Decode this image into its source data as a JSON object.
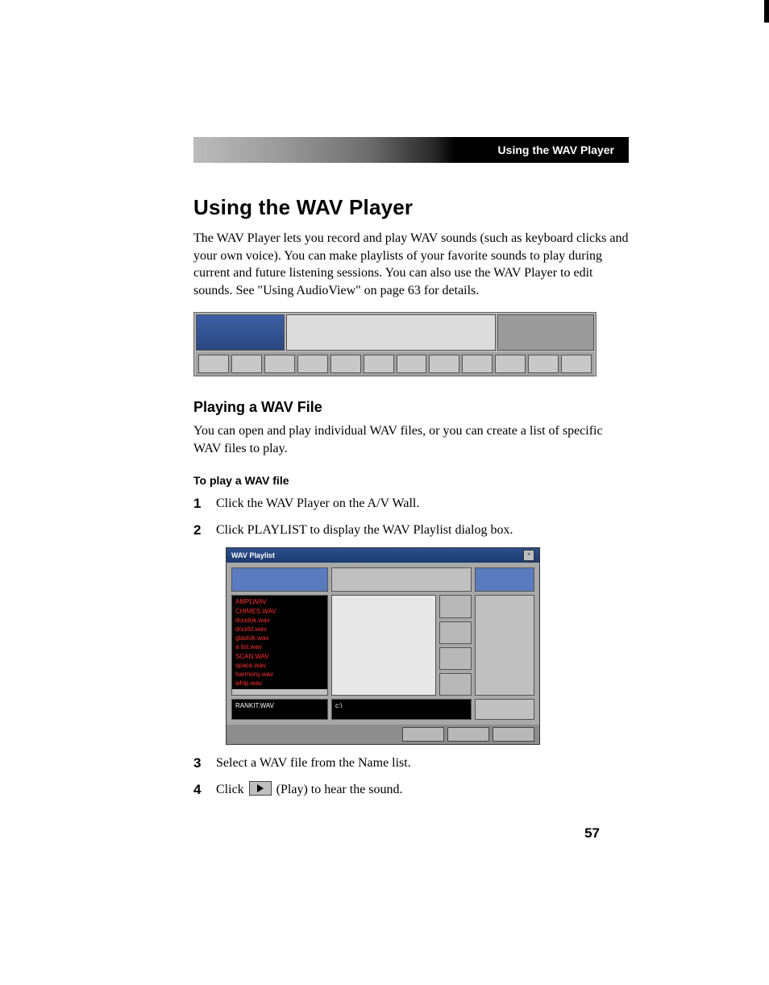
{
  "header_tab": "Using the WAV Player",
  "title": "Using the WAV Player",
  "intro": "The WAV Player lets you record and play WAV sounds (such as keyboard clicks and your own voice). You can make playlists of your favorite sounds to play during current and future listening sessions. You can also use the WAV Player to edit sounds. See \"Using AudioView\" on page 63 for details.",
  "subhead": "Playing a WAV File",
  "sub_intro": "You can open and play individual WAV files, or you can create a list of specific WAV files to play.",
  "proc_head": "To play a WAV file",
  "steps": [
    "Click the WAV Player on the A/V Wall.",
    "Click PLAYLIST to display the WAV Playlist dialog box.",
    "Select a WAV file from the Name list.",
    "(Play) to hear the sound."
  ],
  "step4_prefix": "Click ",
  "dialog": {
    "title": "WAV Playlist",
    "close": "×",
    "list_items": [
      "AMPLWAV",
      "CHIMES.WAV",
      "doodok.wav",
      "doorbl.wav",
      "glaslok.wav",
      "a list.wav",
      "SCAN.WAV",
      "space.wav",
      "harmony.wav",
      "whip.wav"
    ],
    "name_field": "RANKIT.WAV",
    "drives_field": "c:\\"
  },
  "page_number": "57"
}
